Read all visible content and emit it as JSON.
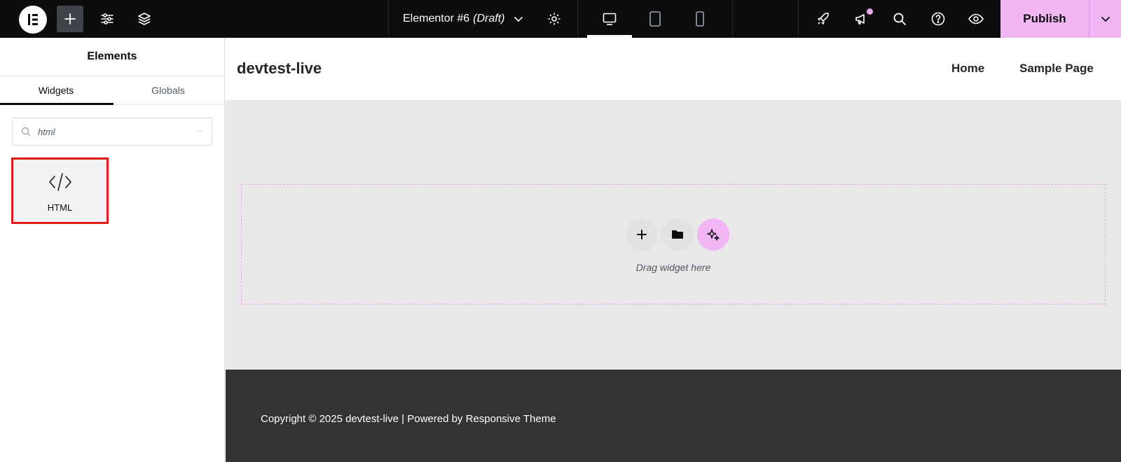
{
  "topbar": {
    "logo_icon": "elementor-logo-icon",
    "add_icon": "plus-icon",
    "settings_icon": "sliders-icon",
    "structure_icon": "layers-icon",
    "doc_title": "Elementor #6",
    "doc_status": "(Draft)",
    "doc_menu_icon": "chevron-down-icon",
    "page_settings_icon": "gear-icon",
    "devices": [
      "desktop-icon",
      "tablet-icon",
      "mobile-icon"
    ],
    "active_device": "desktop",
    "right_icons": [
      "rocket-icon",
      "megaphone-icon",
      "search-icon",
      "help-icon",
      "eye-icon"
    ],
    "publish_label": "Publish",
    "accent": "#f0b7f4"
  },
  "panel": {
    "title": "Elements",
    "tabs": [
      "Widgets",
      "Globals"
    ],
    "active_tab": "Widgets",
    "search_value": "html",
    "search_clear": "..",
    "widgets": [
      {
        "label": "HTML",
        "icon": "code-icon"
      }
    ]
  },
  "canvas": {
    "site_title": "devtest-live",
    "nav": [
      "Home",
      "Sample Page"
    ],
    "dropzone_text": "Drag widget here",
    "dropzone_buttons": [
      "plus-icon",
      "folder-icon",
      "sparkle-icon"
    ],
    "footer_text": "Copyright © 2025 devtest-live | Powered by Responsive Theme"
  }
}
